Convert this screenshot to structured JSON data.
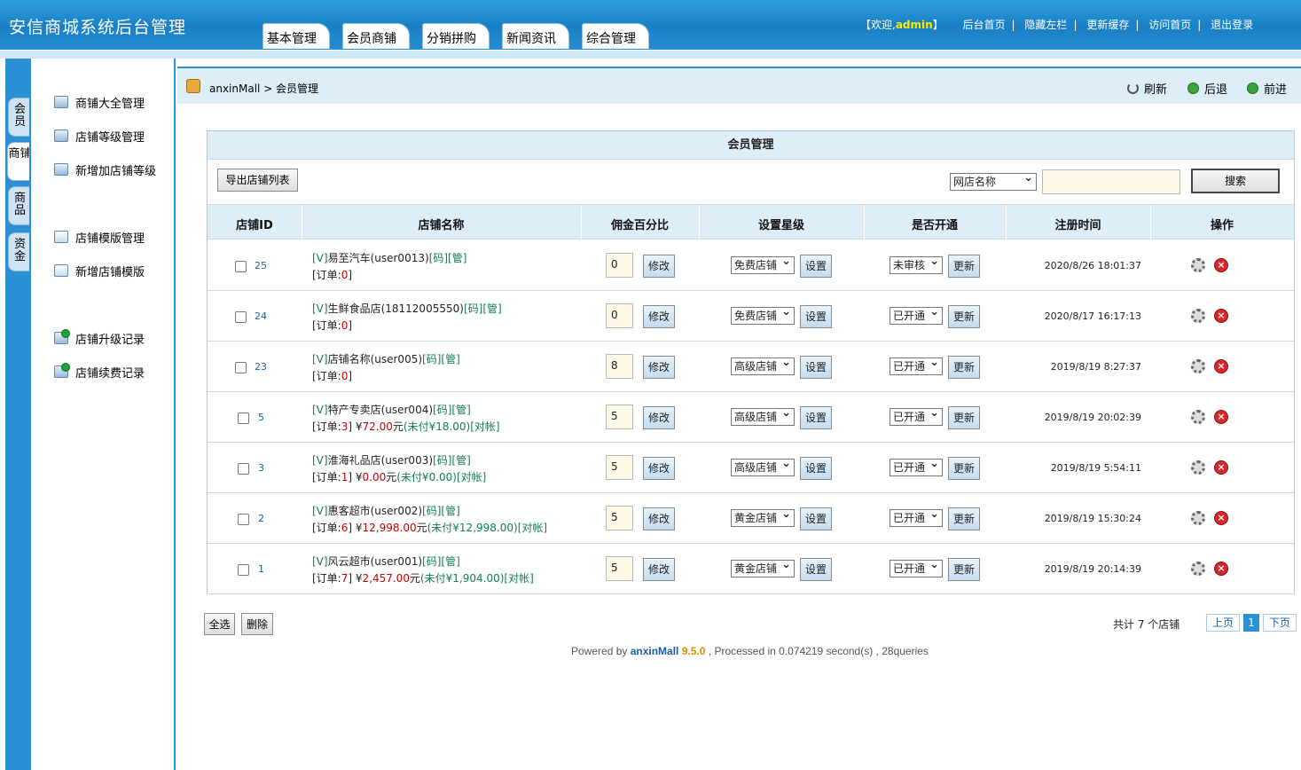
{
  "header": {
    "logo": "安信商城系统后台管理",
    "tabs": [
      "基本管理",
      "会员商铺",
      "分销拼购",
      "新闻资讯",
      "综合管理"
    ],
    "welcome_prefix": "【欢迎,",
    "user": "admin",
    "welcome_suffix": "】",
    "links": [
      "后台首页",
      "隐藏左栏",
      "更新缓存",
      "访问首页",
      "退出登录"
    ]
  },
  "side_tabs": [
    "会员",
    "商铺",
    "商品",
    "资金"
  ],
  "menu": [
    "商铺大全管理",
    "店铺等级管理",
    "新增加店铺等级",
    "店铺模版管理",
    "新增店铺模版",
    "店铺升级记录",
    "店铺续费记录"
  ],
  "breadcrumb": "anxinMall > 会员管理",
  "nav": {
    "refresh": "刷新",
    "back": "后退",
    "forward": "前进"
  },
  "panel": {
    "title": "会员管理",
    "export": "导出店铺列表",
    "search_field": "网店名称",
    "search_btn": "搜索"
  },
  "columns": [
    "店铺ID",
    "店铺名称",
    "佣金百分比",
    "设置星级",
    "是否开通",
    "注册时间",
    "操作"
  ],
  "rows": [
    {
      "id": "25",
      "v": "[V]",
      "name": "易至汽车(user0013)",
      "m": "[码]",
      "g": "[管]",
      "orders": "0",
      "amount": "",
      "unpaid": "",
      "recon": "",
      "commission": "0",
      "edit": "修改",
      "level": "免费店铺",
      "set": "设置",
      "status": "未审核",
      "update": "更新",
      "time": "2020/8/26 18:01:37"
    },
    {
      "id": "24",
      "v": "[V]",
      "name": "生鲜食品店(18112005550)",
      "m": "[码]",
      "g": "[管]",
      "orders": "0",
      "amount": "",
      "unpaid": "",
      "recon": "",
      "commission": "0",
      "edit": "修改",
      "level": "免费店铺",
      "set": "设置",
      "status": "已开通",
      "update": "更新",
      "time": "2020/8/17 16:17:13"
    },
    {
      "id": "23",
      "v": "[V]",
      "name": "店铺名称(user005)",
      "m": "[码]",
      "g": "[管]",
      "orders": "0",
      "amount": "",
      "unpaid": "",
      "recon": "",
      "commission": "8",
      "edit": "修改",
      "level": "高级店铺",
      "set": "设置",
      "status": "已开通",
      "update": "更新",
      "time": "2019/8/19 8:27:37"
    },
    {
      "id": "5",
      "v": "[V]",
      "name": "特产专卖店(user004)",
      "m": "[码]",
      "g": "[管]",
      "orders": "3",
      "amount": "72.00",
      "unpaid": "(未付¥18.00)",
      "recon": "[对帐]",
      "commission": "5",
      "edit": "修改",
      "level": "高级店铺",
      "set": "设置",
      "status": "已开通",
      "update": "更新",
      "time": "2019/8/19 20:02:39"
    },
    {
      "id": "3",
      "v": "[V]",
      "name": "淮海礼品店(user003)",
      "m": "[码]",
      "g": "[管]",
      "orders": "1",
      "amount": "0.00",
      "unpaid": "(未付¥0.00)",
      "recon": "[对帐]",
      "commission": "5",
      "edit": "修改",
      "level": "高级店铺",
      "set": "设置",
      "status": "已开通",
      "update": "更新",
      "time": "2019/8/19 5:54:11"
    },
    {
      "id": "2",
      "v": "[V]",
      "name": "惠客超市(user002)",
      "m": "[码]",
      "g": "[管]",
      "orders": "6",
      "amount": "12,998.00",
      "unpaid": "(未付¥12,998.00)",
      "recon": "[对帐]",
      "commission": "5",
      "edit": "修改",
      "level": "黄金店铺",
      "set": "设置",
      "status": "已开通",
      "update": "更新",
      "time": "2019/8/19 15:30:24"
    },
    {
      "id": "1",
      "v": "[V]",
      "name": "风云超市(user001)",
      "m": "[码]",
      "g": "[管]",
      "orders": "7",
      "amount": "2,457.00",
      "unpaid": "(未付¥1,904.00)",
      "recon": "[对帐]",
      "commission": "5",
      "edit": "修改",
      "level": "黄金店铺",
      "set": "设置",
      "status": "已开通",
      "update": "更新",
      "time": "2019/8/19 20:14:39"
    }
  ],
  "bottom": {
    "select_all": "全选",
    "delete": "删除",
    "total": "共计 7 个店铺",
    "prev": "上页",
    "page": "1",
    "next": "下页"
  },
  "footer": {
    "pre": "Powered by ",
    "brand": "anxinMall",
    "ver": "9.5.0",
    "post": " , Processed in 0.074219 second(s) , 28queries"
  },
  "strings": {
    "order_pre": "[订单:",
    "order_post": "]",
    "yen": " ¥",
    "yuan": "元"
  }
}
